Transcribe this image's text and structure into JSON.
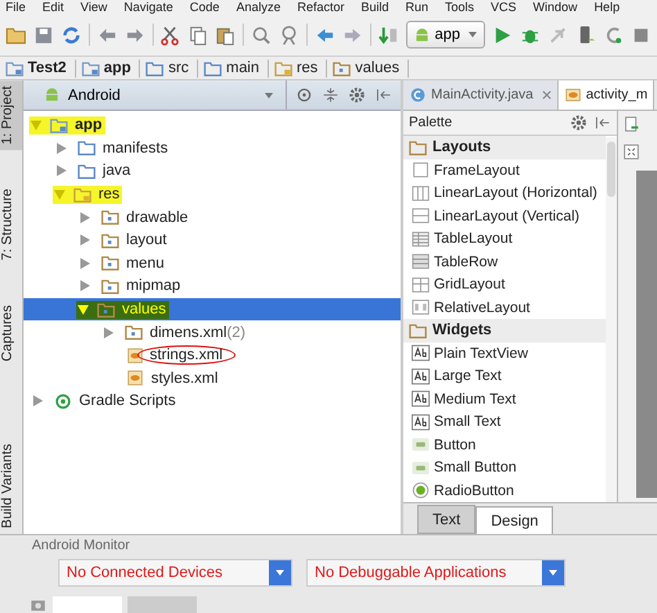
{
  "menu": [
    "File",
    "Edit",
    "View",
    "Navigate",
    "Code",
    "Analyze",
    "Refactor",
    "Build",
    "Run",
    "Tools",
    "VCS",
    "Window",
    "Help"
  ],
  "toolbar": {
    "run_config": "app"
  },
  "breadcrumbs": [
    {
      "label": "Test2",
      "kind": "module"
    },
    {
      "label": "app",
      "kind": "module"
    },
    {
      "label": "src",
      "kind": "folder"
    },
    {
      "label": "main",
      "kind": "folder"
    },
    {
      "label": "res",
      "kind": "res"
    },
    {
      "label": "values",
      "kind": "values"
    }
  ],
  "side_tabs": [
    {
      "label": "1: Project",
      "selected": true
    },
    {
      "label": "7: Structure",
      "selected": false
    },
    {
      "label": "Captures",
      "selected": false
    },
    {
      "label": "Build Variants",
      "selected": false
    }
  ],
  "project": {
    "view": "Android",
    "tree": [
      {
        "label": "app",
        "kind": "module",
        "expanded": true,
        "highlighted": true,
        "selected": false,
        "circled": false,
        "children": [
          {
            "label": "manifests",
            "kind": "folder",
            "expanded": false,
            "highlighted": false,
            "selected": false,
            "circled": false
          },
          {
            "label": "java",
            "kind": "folder",
            "expanded": false,
            "highlighted": false,
            "selected": false,
            "circled": false
          },
          {
            "label": "res",
            "kind": "res",
            "expanded": true,
            "highlighted": true,
            "selected": false,
            "circled": false,
            "children": [
              {
                "label": "drawable",
                "kind": "values",
                "expanded": false,
                "highlighted": false,
                "selected": false,
                "circled": false
              },
              {
                "label": "layout",
                "kind": "values",
                "expanded": false,
                "highlighted": false,
                "selected": false,
                "circled": false
              },
              {
                "label": "menu",
                "kind": "values",
                "expanded": false,
                "highlighted": false,
                "selected": false,
                "circled": false
              },
              {
                "label": "mipmap",
                "kind": "values",
                "expanded": false,
                "highlighted": false,
                "selected": false,
                "circled": false
              },
              {
                "label": "values",
                "kind": "values",
                "expanded": true,
                "highlighted": true,
                "selected": true,
                "circled": false,
                "children": [
                  {
                    "label": "dimens.xml",
                    "count": "(2)",
                    "kind": "values",
                    "expanded": false,
                    "highlighted": false,
                    "selected": false,
                    "circled": false
                  },
                  {
                    "label": "strings.xml",
                    "kind": "xml",
                    "highlighted": false,
                    "selected": false,
                    "circled": true
                  },
                  {
                    "label": "styles.xml",
                    "kind": "xml",
                    "highlighted": false,
                    "selected": false,
                    "circled": false
                  }
                ]
              }
            ]
          }
        ]
      },
      {
        "label": "Gradle Scripts",
        "kind": "gradle",
        "expanded": false,
        "highlighted": false,
        "selected": false,
        "circled": false
      }
    ]
  },
  "editor_tabs": [
    {
      "label": "MainActivity.java",
      "kind": "java",
      "selected": false
    },
    {
      "label": "activity_m",
      "kind": "layout",
      "selected": true
    }
  ],
  "palette": {
    "title": "Palette",
    "groups": [
      {
        "label": "Layouts",
        "items": [
          {
            "label": "FrameLayout",
            "kind": "frame"
          },
          {
            "label": "LinearLayout (Horizontal)",
            "kind": "hlinear"
          },
          {
            "label": "LinearLayout (Vertical)",
            "kind": "vlinear"
          },
          {
            "label": "TableLayout",
            "kind": "table"
          },
          {
            "label": "TableRow",
            "kind": "tablerow"
          },
          {
            "label": "GridLayout",
            "kind": "grid"
          },
          {
            "label": "RelativeLayout",
            "kind": "relative"
          }
        ]
      },
      {
        "label": "Widgets",
        "items": [
          {
            "label": "Plain TextView",
            "kind": "text"
          },
          {
            "label": "Large Text",
            "kind": "text"
          },
          {
            "label": "Medium Text",
            "kind": "text"
          },
          {
            "label": "Small Text",
            "kind": "text"
          },
          {
            "label": "Button",
            "kind": "button"
          },
          {
            "label": "Small Button",
            "kind": "button"
          },
          {
            "label": "RadioButton",
            "kind": "radio"
          }
        ]
      }
    ]
  },
  "bottom_tabs": [
    {
      "label": "Text",
      "selected": false
    },
    {
      "label": "Design",
      "selected": true
    }
  ],
  "monitor": {
    "title": "Android Monitor",
    "device": "No Connected Devices",
    "app": "No Debuggable Applications"
  }
}
